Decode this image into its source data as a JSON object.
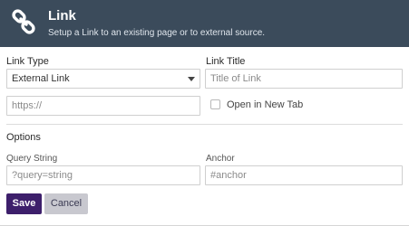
{
  "header": {
    "title": "Link",
    "subtitle": "Setup a Link to an existing page or to external source.",
    "icon": "link-icon"
  },
  "form": {
    "link_type_label": "Link Type",
    "link_type_value": "External Link",
    "link_title_label": "Link Title",
    "link_title_placeholder": "Title of Link",
    "url_placeholder": "https://",
    "open_new_tab_label": "Open in New Tab",
    "open_new_tab_checked": false,
    "options_label": "Options",
    "query_label": "Query String",
    "query_placeholder": "?query=string",
    "anchor_label": "Anchor",
    "anchor_placeholder": "#anchor"
  },
  "buttons": {
    "save_label": "Save",
    "cancel_label": "Cancel"
  },
  "colors": {
    "header_bg": "#3b4b5b",
    "save_bg": "#3d1f6b",
    "cancel_bg": "#c8c8cf"
  }
}
